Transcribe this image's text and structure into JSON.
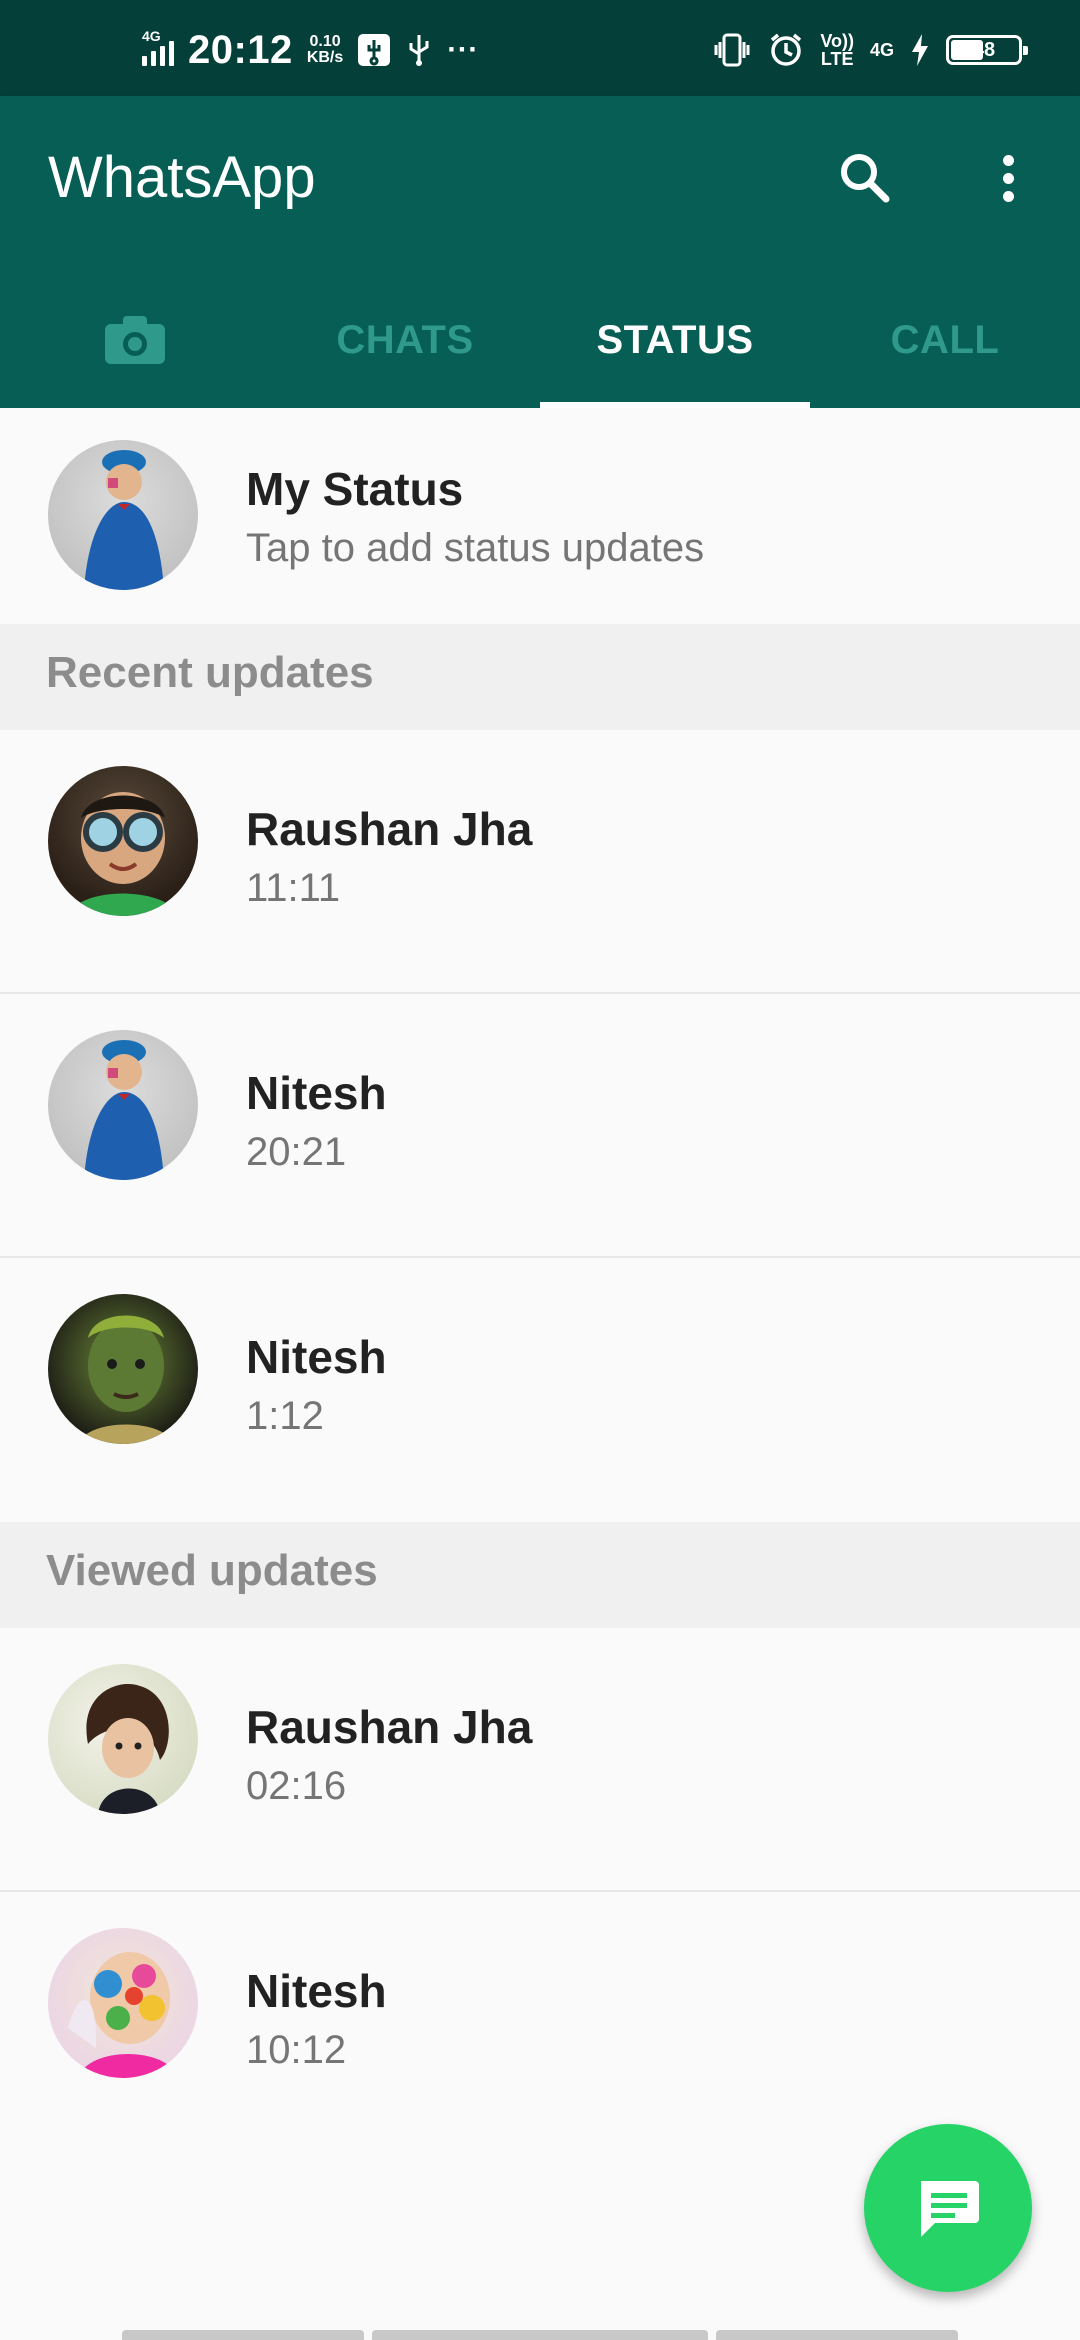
{
  "status_bar": {
    "signal_tag": "4G",
    "time": "20:12",
    "net_speed_value": "0.10",
    "net_speed_unit": "KB/s",
    "more": "···",
    "volte_top": "Vo))",
    "volte_bottom": "LTE",
    "net_4g": "4G",
    "battery": "48"
  },
  "app_bar": {
    "title": "WhatsApp",
    "search_icon": "search-icon",
    "menu_icon": "more-vert-icon"
  },
  "tabs": [
    {
      "label": "",
      "icon": "camera-icon"
    },
    {
      "label": "CHATS"
    },
    {
      "label": "STATUS",
      "active": true
    },
    {
      "label": "CALL"
    }
  ],
  "my_status": {
    "name": "My Status",
    "subtitle": "Tap to add status updates"
  },
  "recent": {
    "header": "Recent updates",
    "items": [
      {
        "name": "Raushan Jha",
        "time": "11:11"
      },
      {
        "name": "Nitesh",
        "time": "20:21"
      },
      {
        "name": "Nitesh",
        "time": "1:12"
      }
    ]
  },
  "viewed": {
    "header": "Viewed updates",
    "items": [
      {
        "name": "Raushan Jha",
        "time": "02:16"
      },
      {
        "name": "Nitesh",
        "time": "10:12"
      }
    ]
  },
  "fab": {
    "icon": "message-icon"
  },
  "colors": {
    "status_bar": "#053f39",
    "app_bar": "#075e54",
    "tab_inactive": "#2f9a8c",
    "fab": "#25d366"
  }
}
